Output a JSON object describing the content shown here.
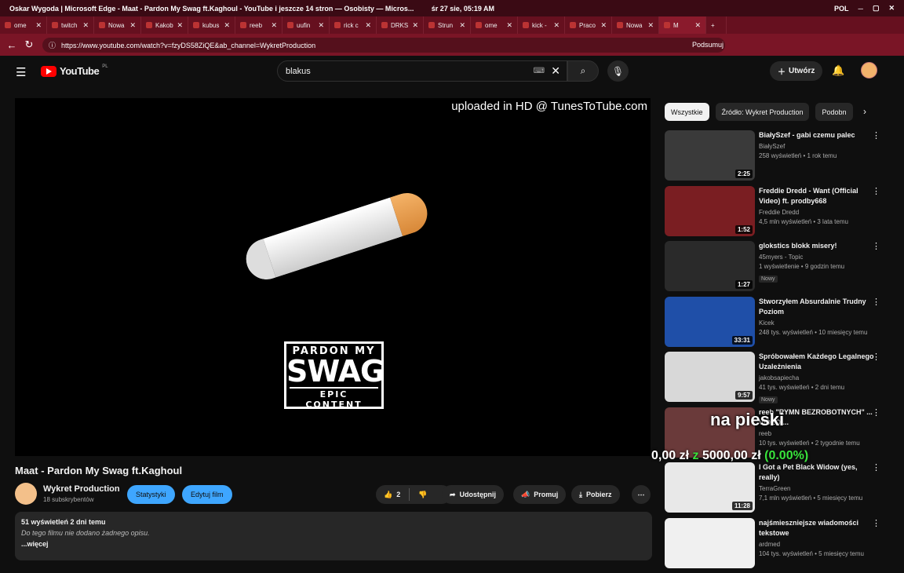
{
  "window": {
    "title": "Oskar Wygoda  |  Microsoft Edge - Maat - Pardon My Swag ft.Kaghoul - YouTube i jeszcze 14 stron — Osobisty — Micros...",
    "datetime": "śr 27 sie, 05:19 AM",
    "lang": "POL"
  },
  "tabs": [
    {
      "label": "ome"
    },
    {
      "label": "twitch"
    },
    {
      "label": "Nowa"
    },
    {
      "label": "Kakob"
    },
    {
      "label": "kubus"
    },
    {
      "label": "reeb"
    },
    {
      "label": "uufin"
    },
    {
      "label": "rick c"
    },
    {
      "label": "DRKS"
    },
    {
      "label": "Strun"
    },
    {
      "label": "ome"
    },
    {
      "label": "kick -"
    },
    {
      "label": "Praco"
    },
    {
      "label": "Nowa"
    },
    {
      "label": "M"
    }
  ],
  "address": {
    "url": "https://www.youtube.com/watch?v=fzyDS58ZiQE&ab_channel=WykretProduction",
    "summarize": "Podsumuj"
  },
  "youtube": {
    "logo": "YouTube",
    "region": "PL",
    "search_value": "blakus",
    "create_label": "Utwórz"
  },
  "video": {
    "overlay_text": "uploaded in HD @ TunesToTube.com",
    "cover_line1": "PARDON MY",
    "cover_line2": "SWAG",
    "cover_line3": "EPIC CONTENT",
    "title": "Maat - Pardon My Swag ft.Kaghoul",
    "channel": "Wykret Production",
    "subscribers": "18 subskrybentów",
    "stats_label": "Statystyki",
    "edit_label": "Edytuj film",
    "likes": "2",
    "share_label": "Udostępnij",
    "promote_label": "Promuj",
    "download_label": "Pobierz",
    "views_meta": "51 wyświetleń  2 dni temu",
    "description": "Do tego filmu nie dodano żadnego opisu.",
    "more_label": "...więcej"
  },
  "chips": [
    "Wszystkie",
    "Źródło: Wykret Production",
    "Podobn"
  ],
  "recommendations": [
    {
      "title": "BiałySzef - gabi czemu palec",
      "channel": "BiałySzef",
      "meta": "258 wyświetleń • 1 rok temu",
      "duration": "2:25",
      "badge": "",
      "color": "#3a3a3a"
    },
    {
      "title": "Freddie Dredd - Want (Official Video) ft. prodby668",
      "channel": "Freddie Dredd",
      "meta": "4,5 mln wyświetleń • 3 lata temu",
      "duration": "1:52",
      "badge": "",
      "color": "#7a1e22"
    },
    {
      "title": "glokstics blokk misery!",
      "channel": "45myers - Topic",
      "meta": "1 wyświetlenie • 9 godzin temu",
      "duration": "1:27",
      "badge": "Nowy",
      "color": "#2a2a2a"
    },
    {
      "title": "Stworzyłem Absurdalnie Trudny Poziom",
      "channel": "Kicek",
      "meta": "248 tys. wyświetleń • 10 miesięcy temu",
      "duration": "33:31",
      "badge": "",
      "color": "#1f4fa8"
    },
    {
      "title": "Spróbowałem Każdego Legalnego Uzależnienia",
      "channel": "jakobsapiecha",
      "meta": "41 tys. wyświetleń • 2 dni temu",
      "duration": "9:57",
      "badge": "Nowy",
      "color": "#d8d8d8"
    },
    {
      "title": "reeb \"RYMN BEZROBOTNYCH\" ... VIDEO ...",
      "channel": "reeb",
      "meta": "10 tys. wyświetleń • 2 tygodnie temu",
      "duration": "",
      "badge": "",
      "color": "#6a3a3a"
    },
    {
      "title": "I Got a Pet Black Widow (yes, really)",
      "channel": "TerraGreen",
      "meta": "7,1 mln wyświetleń • 5 miesięcy temu",
      "duration": "11:28",
      "badge": "",
      "color": "#e8e8e8"
    },
    {
      "title": "najśmieszniejsze wiadomości tekstowe",
      "channel": "ardmed",
      "meta": "104 tys. wyświetleń • 5 miesięcy temu",
      "duration": "",
      "badge": "",
      "color": "#f0f0f0"
    }
  ],
  "stream_overlay": {
    "label": "na pieski",
    "current": "0,00 zł",
    "z": "z",
    "goal": "5000,00 zł",
    "percent": "(0.00%)"
  },
  "colors": {
    "titlebar": "#3a0a14",
    "tabsbar": "#66101f",
    "youtube_red": "#ff0000",
    "pill_blue": "#3ea6ff",
    "goal_green": "#39e33c"
  }
}
